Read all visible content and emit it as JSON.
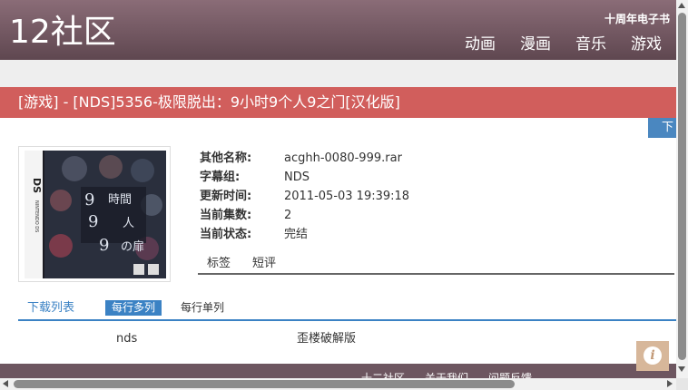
{
  "site": {
    "logo": "12社区",
    "top_link": "十周年电子书",
    "nav": [
      "动画",
      "漫画",
      "音乐",
      "游戏"
    ]
  },
  "page": {
    "title": "[游戏] - [NDS]5356-极限脱出：9小时9个人9之门[汉化版]",
    "download_tab": "下"
  },
  "info": [
    {
      "key": "其他名称:",
      "value": "acghh-0080-999.rar"
    },
    {
      "key": "字幕组:",
      "value": "NDS"
    },
    {
      "key": "更新时间:",
      "value": "2011-05-03 19:39:18"
    },
    {
      "key": "当前集数:",
      "value": "2"
    },
    {
      "key": "当前状态:",
      "value": "完结"
    }
  ],
  "tabs": [
    "标签",
    "短评"
  ],
  "download_list": {
    "title": "下载列表",
    "btn_multi": "每行多列",
    "btn_single": "每行单列",
    "rows": [
      {
        "col1": "nds",
        "col2": "歪楼破解版"
      }
    ]
  },
  "footer": {
    "links": [
      "十二社区",
      "关于我们",
      "问题反馈"
    ]
  },
  "colors": {
    "header": "#6b525b",
    "title_bar": "#d15e5c",
    "accent_blue": "#3b82c4"
  }
}
